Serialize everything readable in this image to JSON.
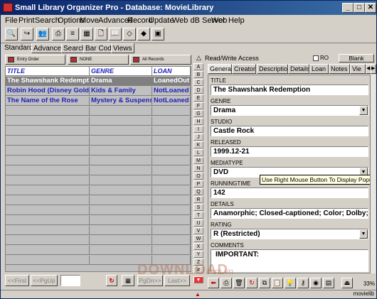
{
  "window": {
    "title": "Small Library Organizer Pro - Database: MovieLibrary"
  },
  "menu": [
    "File",
    "Print",
    "Search",
    "Options",
    "Move",
    "Advanced",
    "Record",
    "Update",
    "Web dB Server",
    "Web",
    "Help"
  ],
  "view_tabs": [
    "Standard",
    "Advanced",
    "Search",
    "Bar Code",
    "Views"
  ],
  "sort_bar": {
    "entry_order": "Entry Order",
    "none": "NONE",
    "all_records": "All Records"
  },
  "grid": {
    "columns": [
      "TITLE",
      "GENRE",
      "LOAN"
    ],
    "rows": [
      {
        "title": "The Shawshank Redemptic",
        "genre": "Drama",
        "loan": "LoanedOut"
      },
      {
        "title": "Robin Hood (Disney Gold C",
        "genre": "Kids & Family",
        "loan": "NotLoaned"
      },
      {
        "title": "The Name of the Rose",
        "genre": "Mystery & Suspense",
        "loan": "NotLoaned"
      }
    ]
  },
  "nav": {
    "first": "<<First",
    "pgup": "<<PgUp",
    "pgdn": "PgDn>>",
    "last": "Last>>"
  },
  "letters": [
    "A",
    "B",
    "C",
    "D",
    "E",
    "F",
    "G",
    "H",
    "I",
    "J",
    "K",
    "L",
    "M",
    "N",
    "O",
    "P",
    "Q",
    "R",
    "S",
    "T",
    "U",
    "V",
    "W",
    "X",
    "Y",
    "Z",
    "#"
  ],
  "detail": {
    "read_write": "Read/Write Access",
    "ro_label": "RO",
    "blank_label": "Blank",
    "tabs": [
      "General",
      "Creators",
      "Description",
      "Details",
      "Loan",
      "Notes",
      "Vie"
    ],
    "fields": {
      "title": {
        "label": "TITLE",
        "value": "The Shawshank Redemption"
      },
      "genre": {
        "label": "GENRE",
        "value": "Drama"
      },
      "studio": {
        "label": "STUDIO",
        "value": "Castle Rock"
      },
      "released": {
        "label": "RELEASED",
        "value": "1999.12-21"
      },
      "mediatype": {
        "label": "MEDIATYPE",
        "value": "DVD"
      },
      "runningtime": {
        "label": "RUNNINGTIME",
        "value": "142"
      },
      "details": {
        "label": "DETAILS",
        "value": "Anamorphic; Closed-captioned; Color; Dolby; DVD-"
      },
      "rating": {
        "label": "RATING",
        "value": "R (Restricted)"
      },
      "comments": {
        "label": "COMMENTS",
        "value": "IMPORTANT:"
      }
    },
    "tooltip": "Use Right Mouse Button To Display Popup Menus"
  },
  "status": {
    "zoom": "33%",
    "db": "movielib"
  },
  "watermark": {
    "main": "DOWNLOAD",
    "sub": ".com.vn"
  },
  "colors": {
    "grid_text": "#1f1fb8",
    "title_bar": "#0a246a",
    "selected_row": "#808080"
  }
}
